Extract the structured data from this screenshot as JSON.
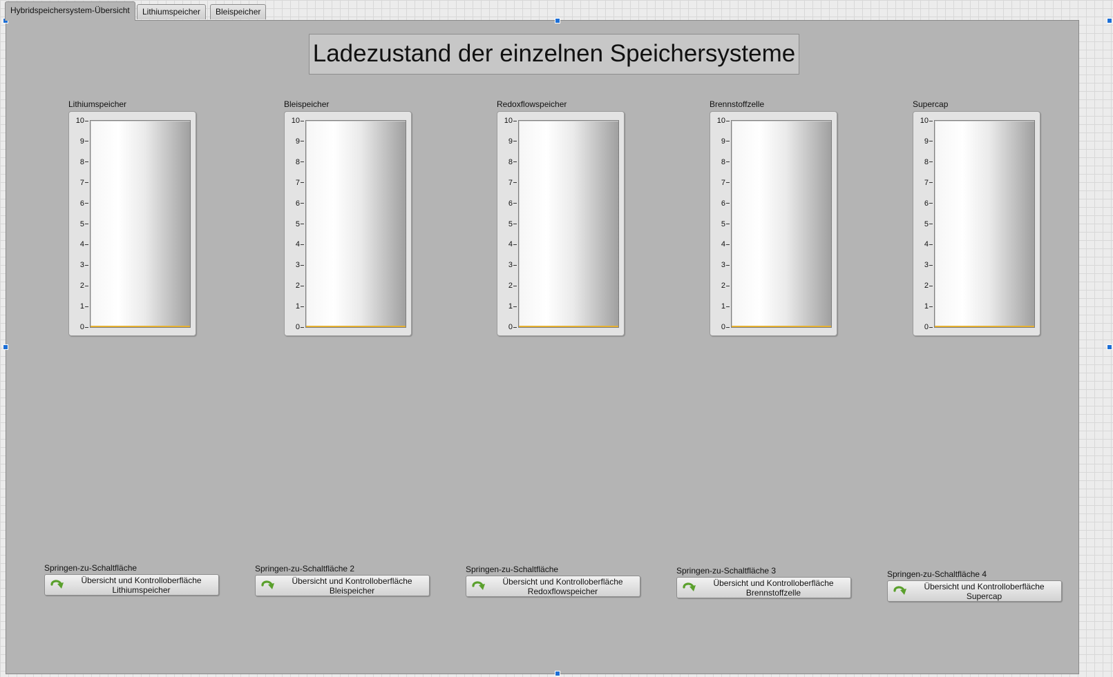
{
  "tabs": [
    {
      "label": "Hybridspeichersystem-Übersicht",
      "active": true
    },
    {
      "label": "Lithiumspeicher",
      "active": false
    },
    {
      "label": "Bleispeicher",
      "active": false
    }
  ],
  "title": "Ladezustand der einzelnen Speichersysteme",
  "scale_ticks": [
    "10",
    "9",
    "8",
    "7",
    "6",
    "5",
    "4",
    "3",
    "2",
    "1",
    "0"
  ],
  "gauges": [
    {
      "label": "Lithiumspeicher",
      "value": 0
    },
    {
      "label": "Bleispeicher",
      "value": 0
    },
    {
      "label": "Redoxflowspeicher",
      "value": 0
    },
    {
      "label": "Brennstoffzelle",
      "value": 0
    },
    {
      "label": "Supercap",
      "value": 0
    }
  ],
  "jump_buttons": [
    {
      "caption": "Springen-zu-Schaltfläche",
      "line1": "Übersicht und Kontrolloberfläche",
      "line2": "Lithiumspeicher"
    },
    {
      "caption": "Springen-zu-Schaltfläche 2",
      "line1": "Übersicht und Kontrolloberfläche",
      "line2": "Bleispeicher"
    },
    {
      "caption": "Springen-zu-Schaltfläche",
      "line1": "Übersicht und Kontrolloberfläche",
      "line2": "Redoxflowspeicher"
    },
    {
      "caption": "Springen-zu-Schaltfläche 3",
      "line1": "Übersicht und Kontrolloberfläche",
      "line2": "Brennstoffzelle"
    },
    {
      "caption": "Springen-zu-Schaltfläche 4",
      "line1": "Übersicht und Kontrolloberfläche",
      "line2": "Supercap"
    }
  ],
  "colors": {
    "panel": "#b4b4b4",
    "selection_handle": "#1d6fd6",
    "fill_level": "#e7b232",
    "arrow_icon": "#5aa02c"
  },
  "icons": {
    "jump_button": "green-curved-arrow-icon"
  }
}
